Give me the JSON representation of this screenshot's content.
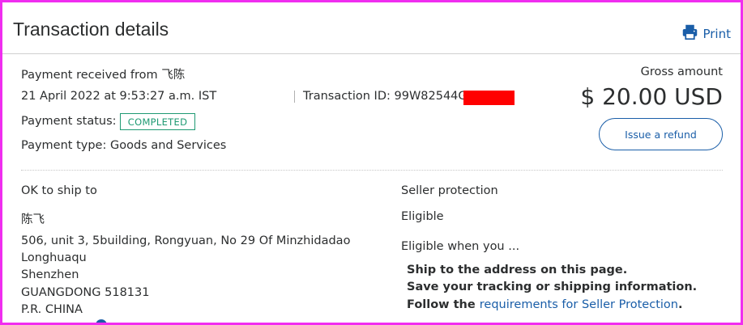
{
  "header": {
    "title": "Transaction details",
    "print_label": "Print",
    "print_icon": "printer-icon"
  },
  "summary": {
    "payment_received_label": "Payment received from 飞陈",
    "datetime": "21 April 2022 at 9:53:27 a.m. IST",
    "transaction_id": "Transaction ID: 99W82544GC",
    "payment_status_label": "Payment status:",
    "payment_status_value": "COMPLETED",
    "payment_type": "Payment type: Goods and Services",
    "gross_amount_label": "Gross amount",
    "gross_amount_value": "$ 20.00 USD",
    "refund_button_label": "Issue a refund"
  },
  "shipping": {
    "heading": "OK to ship to",
    "name": "陈飞",
    "address_lines": [
      "506, unit 3, 5building, Rongyuan, No 29 Of Minzhidadao",
      "Longhuaqu",
      "Shenzhen",
      "GUANGDONG 518131",
      "P.R. CHINA"
    ]
  },
  "seller_protection": {
    "heading": "Seller protection",
    "status": "Eligible",
    "eligible_when": "Eligible when you ...",
    "steps": [
      "Ship to the address on this page.",
      "Save your tracking or shipping information."
    ],
    "follow_prefix": "Follow the ",
    "follow_link": "requirements for Seller Protection",
    "follow_suffix": "."
  },
  "colors": {
    "accent": "#1a5ea8",
    "status_green": "#1f9a73",
    "frame_highlight": "#f02df0",
    "redaction": "#ff0000"
  }
}
